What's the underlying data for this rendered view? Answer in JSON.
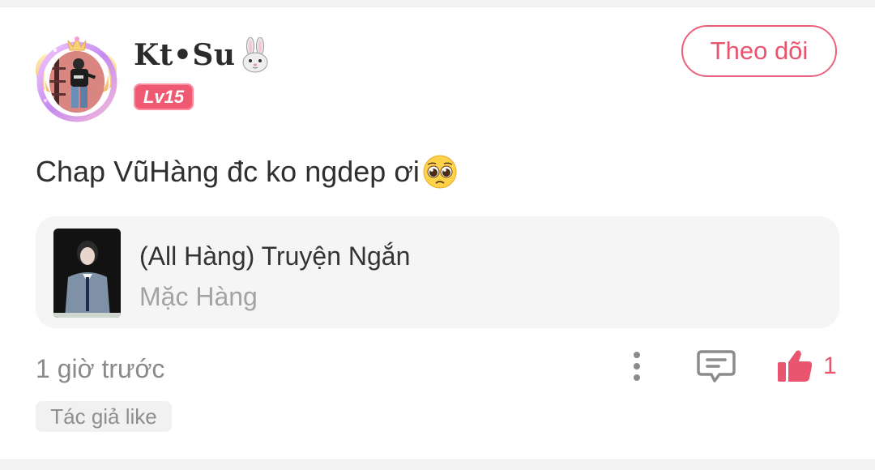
{
  "user": {
    "name": "Kt•Su",
    "badge_level": "Lv15",
    "avatar_icon": "avatar-frame-icon"
  },
  "follow_button": {
    "label": "Theo dõi"
  },
  "post": {
    "text": "Chap VũHàng đc ko ngdep ơi",
    "emoji": "pleading-face-emoji"
  },
  "story": {
    "title": "(All Hàng) Truyện Ngắn",
    "author": "Mặc Hàng"
  },
  "footer": {
    "timestamp": "1 giờ trước",
    "like_count": "1",
    "author_like_tag": "Tác giả like"
  },
  "colors": {
    "accent": "#e9556f",
    "badge": "#ef5a72",
    "card_bg": "#f5f5f5",
    "muted_text": "#8a8a8a"
  }
}
